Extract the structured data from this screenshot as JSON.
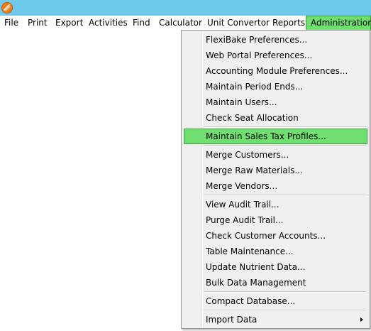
{
  "window": {
    "icon": "flexibake-app-icon"
  },
  "menubar": {
    "items": [
      {
        "label": "File"
      },
      {
        "label": "Print"
      },
      {
        "label": "Export"
      },
      {
        "label": "Activities"
      },
      {
        "label": "Find"
      },
      {
        "label": "Calculator"
      },
      {
        "label": "Unit Convertor"
      },
      {
        "label": "Reports"
      },
      {
        "label": "Administration",
        "active": true
      }
    ]
  },
  "administration_menu": {
    "items": [
      {
        "label": "FlexiBake Preferences..."
      },
      {
        "label": "Web Portal Preferences..."
      },
      {
        "label": "Accounting Module Preferences..."
      },
      {
        "label": "Maintain Period Ends..."
      },
      {
        "label": "Maintain Users..."
      },
      {
        "label": "Check Seat Allocation"
      },
      {
        "label": "Maintain Sales Tax Profiles...",
        "highlighted": true
      },
      {
        "label": "Merge Customers..."
      },
      {
        "label": "Merge Raw Materials..."
      },
      {
        "label": "Merge Vendors..."
      },
      {
        "label": "View Audit Trail..."
      },
      {
        "label": "Purge Audit Trail..."
      },
      {
        "label": "Check Customer Accounts..."
      },
      {
        "label": "Table Maintenance..."
      },
      {
        "label": "Update Nutrient Data..."
      },
      {
        "label": "Bulk Data Management"
      },
      {
        "label": "Compact Database..."
      },
      {
        "label": "Import Data",
        "submenu": true
      }
    ]
  },
  "colors": {
    "titlebar": "#6ec9ea",
    "highlight": "#6fe06f",
    "highlight_border": "#3a9d3a",
    "menu_background": "#f0f0f0"
  }
}
